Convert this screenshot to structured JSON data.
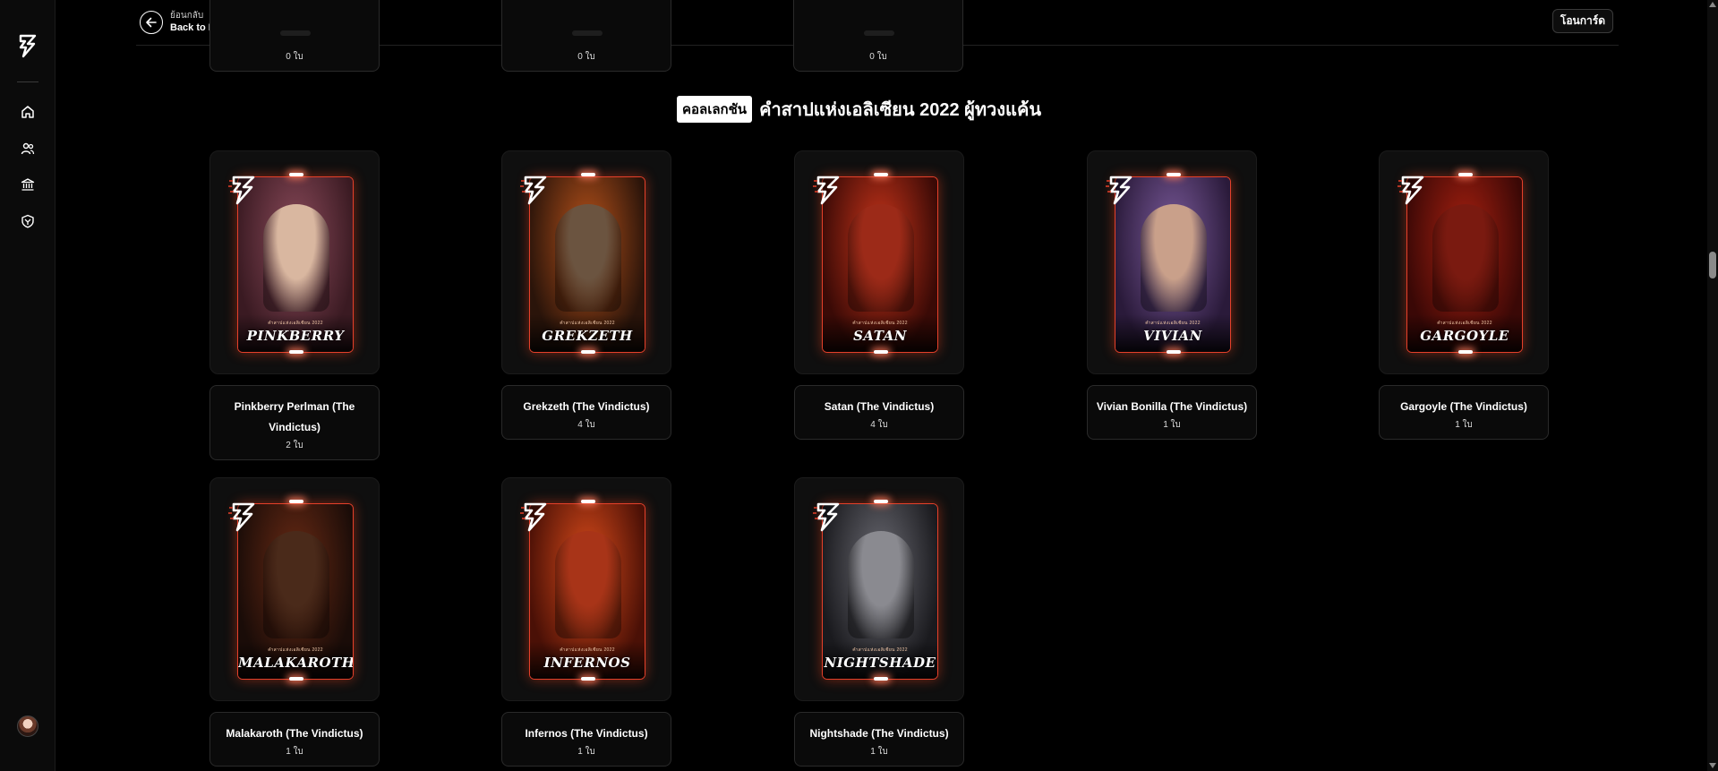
{
  "sidebar": {
    "nav_icons": [
      "home-icon",
      "users-icon",
      "bank-icon",
      "shield-icon"
    ]
  },
  "header": {
    "back_small": "ย้อนกลับ",
    "back_label": "Back to Marketplace",
    "transfer_label": "โอนการ์ด"
  },
  "previous_row": {
    "counts": [
      "0 ใบ",
      "0 ใบ",
      "0 ใบ"
    ]
  },
  "collection": {
    "badge": "คอลเลกชัน",
    "title": "คำสาปแห่งเอลิเซียน 2022 ผู้ทวงแค้น"
  },
  "cards": [
    {
      "name": "PINKBERRY",
      "title": "Pinkberry Perlman (The Vindictus)",
      "count": "2 ใบ",
      "subtext": "คำสาปแห่งเอลิเซียน 2022",
      "theme": {
        "bg1": "#3a1a22",
        "bg2": "#8a4a5a",
        "fig": "#d9b7a0"
      }
    },
    {
      "name": "GREKZETH",
      "title": "Grekzeth (The Vindictus)",
      "count": "4 ใบ",
      "subtext": "คำสาปแห่งเอลิเซียน 2022",
      "theme": {
        "bg1": "#2a140a",
        "bg2": "#b8521a",
        "fig": "#6b5440"
      }
    },
    {
      "name": "SATAN",
      "title": "Satan (The Vindictus)",
      "count": "4 ใบ",
      "subtext": "คำสาปแห่งเอลิเซียน 2022",
      "theme": {
        "bg1": "#3a0a06",
        "bg2": "#c8341a",
        "fig": "#9c2a18"
      }
    },
    {
      "name": "VIVIAN",
      "title": "Vivian Bonilla (The Vindictus)",
      "count": "1 ใบ",
      "subtext": "คำสาปแห่งเอลิเซียน 2022",
      "theme": {
        "bg1": "#2a1a3a",
        "bg2": "#7a5a9a",
        "fig": "#c9a08a"
      }
    },
    {
      "name": "GARGOYLE",
      "title": "Gargoyle (The Vindictus)",
      "count": "1 ใบ",
      "subtext": "คำสาปแห่งเอลิเซียน 2022",
      "theme": {
        "bg1": "#3a0806",
        "bg2": "#a82010",
        "fig": "#7a1a10"
      }
    },
    {
      "name": "MALAKAROTH",
      "title": "Malakaroth (The Vindictus)",
      "count": "1 ใบ",
      "subtext": "คำสาปแห่งเอลิเซียน 2022",
      "theme": {
        "bg1": "#1a0c08",
        "bg2": "#6a2a14",
        "fig": "#4a2a1a"
      }
    },
    {
      "name": "INFERNOS",
      "title": "Infernos (The Vindictus)",
      "count": "1 ใบ",
      "subtext": "คำสาปแห่งเอลิเซียน 2022",
      "theme": {
        "bg1": "#4a1006",
        "bg2": "#d84a1a",
        "fig": "#a83418"
      }
    },
    {
      "name": "NIGHTSHADE",
      "title": "Nightshade (The Vindictus)",
      "count": "1 ใบ",
      "subtext": "คำสาปแห่งเอลิเซียน 2022",
      "theme": {
        "bg1": "#1a1a1e",
        "bg2": "#6a6a72",
        "fig": "#8a8a90"
      }
    }
  ],
  "colors": {
    "accent": "#e5402a",
    "background": "#000000",
    "panel": "#0f0f0f"
  }
}
